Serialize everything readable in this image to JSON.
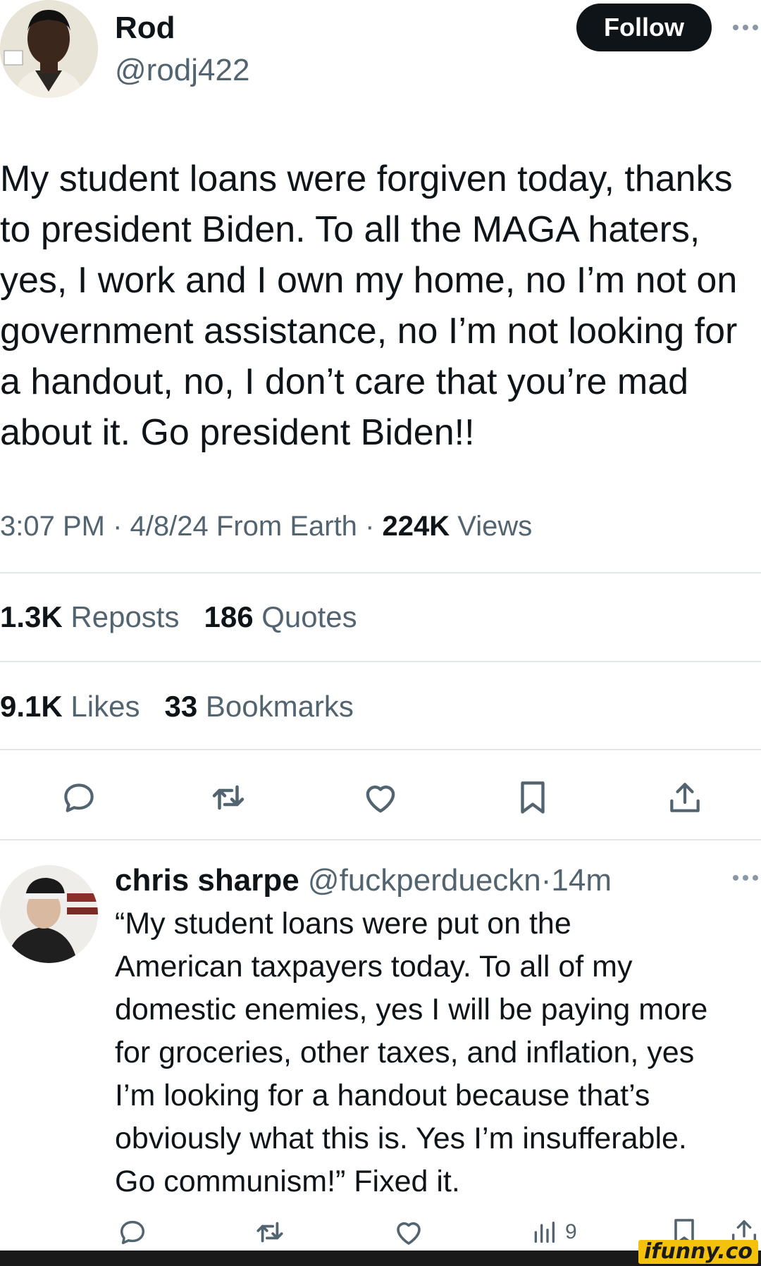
{
  "main_tweet": {
    "display_name": "Rod",
    "handle": "@rodj422",
    "follow_label": "Follow",
    "text": "My student loans were forgiven today, thanks\nto president Biden. To all the MAGA haters,\nyes, I work and I own my home, no I’m not on\ngovernment assistance, no I’m not looking for\na handout, no, I don’t care that you’re mad\nabout it. Go president Biden!!",
    "time": "3:07 PM",
    "date": "4/8/24",
    "location": "From Earth",
    "views_count": "224K",
    "views_label": "Views",
    "separator": "·",
    "reposts_count": "1.3K",
    "reposts_label": "Reposts",
    "quotes_count": "186",
    "quotes_label": "Quotes",
    "likes_count": "9.1K",
    "likes_label": "Likes",
    "bookmarks_count": "33",
    "bookmarks_label": "Bookmarks",
    "actions": [
      "reply-icon",
      "repost-icon",
      "like-icon",
      "bookmark-icon",
      "share-icon"
    ]
  },
  "reply": {
    "display_name": "chris sharpe",
    "handle": "@fuckperdueckn",
    "separator": "·",
    "time_ago": "14m",
    "text": "“My student loans were put on the\nAmerican taxpayers today. To all of my\ndomestic enemies, yes I will be paying more\nfor groceries, other taxes, and inflation, yes\nI’m looking for a handout because that’s\nobviously what this is. Yes I’m insufferable.\nGo communism!” Fixed it.",
    "views_count": "9",
    "actions": [
      "reply-icon",
      "repost-icon",
      "like-icon",
      "views-icon",
      "bookmark-icon",
      "share-icon"
    ]
  },
  "watermark": "ifunny.co",
  "colors": {
    "text_primary": "#0f1419",
    "text_secondary": "#536471",
    "divider": "#e1e6ea",
    "follow_bg": "#0f1419",
    "watermark_bg": "#f4c20d"
  }
}
